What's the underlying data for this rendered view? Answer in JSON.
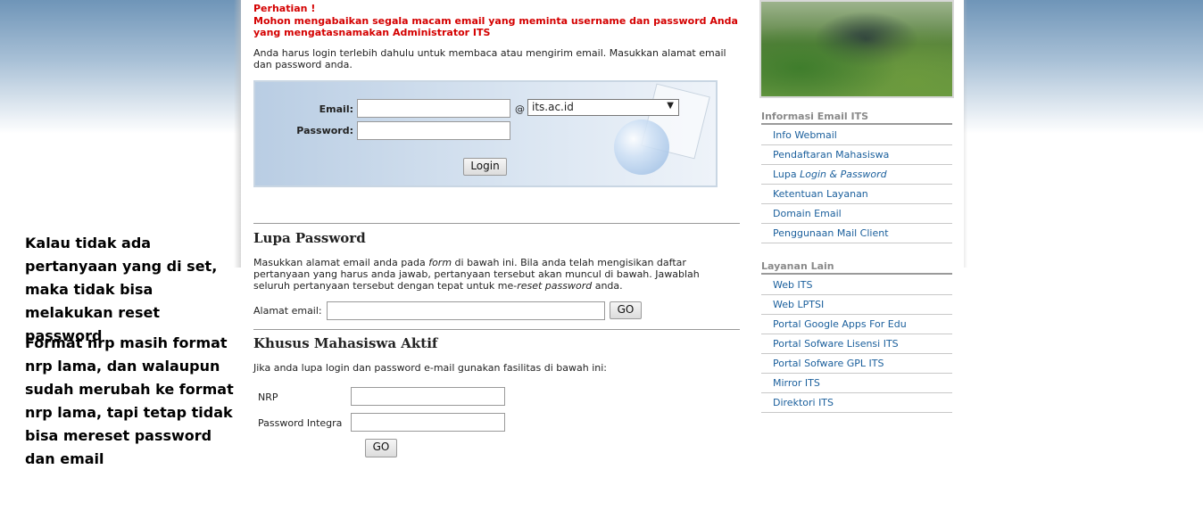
{
  "annotations": [
    "Kalau tidak ada pertanyaan yang di set, maka tidak bisa melakukan reset password",
    "Format nrp masih format nrp lama, dan walaupun sudah merubah ke format nrp lama, tapi tetap tidak bisa mereset password dan email"
  ],
  "warning": {
    "title": "Perhatian !",
    "body": "Mohon mengabaikan segala macam email yang meminta username dan password Anda yang mengatasnamakan Administrator ITS"
  },
  "intro": "Anda harus login terlebih dahulu untuk membaca atau mengirim email. Masukkan alamat email dan password anda.",
  "login": {
    "email_label": "Email:",
    "email_value": "",
    "at_sign": "@",
    "domain_selected": "its.ac.id",
    "password_label": "Password:",
    "password_value": "",
    "button": "Login"
  },
  "lupa_password": {
    "title": "Lupa Password",
    "desc_1": "Masukkan alamat email anda pada ",
    "desc_form": "form",
    "desc_2": " di bawah ini. Bila anda telah mengisikan daftar pertanyaan yang harus anda jawab, pertanyaan tersebut akan muncul di bawah. Jawablah seluruh pertanyaan tersebut dengan tepat untuk me-",
    "desc_reset": "reset password",
    "desc_3": " anda.",
    "alamat_label": "Alamat email:",
    "alamat_value": "",
    "button": "GO"
  },
  "khusus": {
    "title": "Khusus Mahasiswa Aktif",
    "desc": "Jika anda lupa login dan password e-mail gunakan fasilitas di bawah ini:",
    "nrp_label": "NRP",
    "nrp_value": "",
    "pi_label": "Password Integra",
    "pi_value": "",
    "button": "GO"
  },
  "sidebar": {
    "photo_alt": "",
    "section1": {
      "title": "Informasi Email ITS",
      "items": [
        {
          "label": "Info Webmail"
        },
        {
          "label": "Pendaftaran Mahasiswa"
        },
        {
          "label_pre": "Lupa ",
          "label_italic": "Login & Password"
        },
        {
          "label": "Ketentuan Layanan"
        },
        {
          "label": "Domain Email"
        },
        {
          "label": "Penggunaan Mail Client"
        }
      ]
    },
    "section2": {
      "title": "Layanan Lain",
      "items": [
        {
          "label": "Web ITS"
        },
        {
          "label": "Web LPTSI"
        },
        {
          "label": "Portal Google Apps For Edu"
        },
        {
          "label": "Portal Sofware Lisensi ITS"
        },
        {
          "label": "Portal Sofware GPL ITS"
        },
        {
          "label": "Mirror ITS"
        },
        {
          "label": "Direktori ITS"
        }
      ]
    }
  },
  "colors": {
    "warning": "#d40000",
    "link": "#1a5f9c",
    "sidebar_head": "#8a8a8a"
  }
}
